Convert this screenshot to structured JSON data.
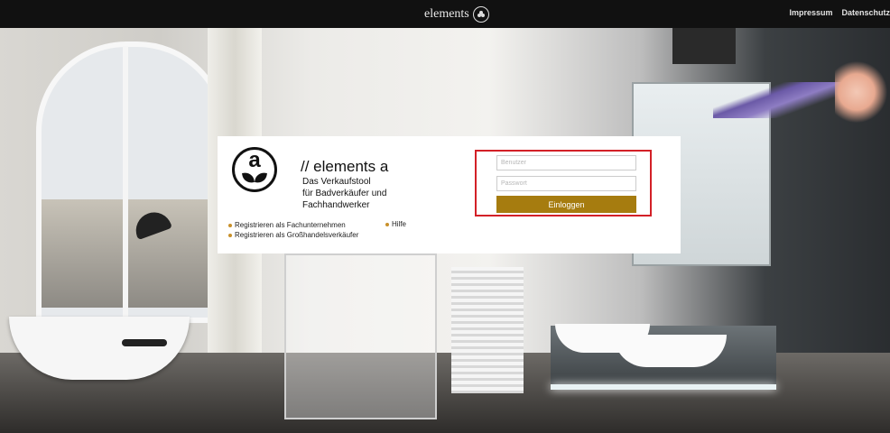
{
  "topbar": {
    "brand": "elements",
    "links": [
      "Impressum",
      "Datenschutz"
    ]
  },
  "card": {
    "title": "// elements a",
    "subtitle_lines": [
      "Das Verkaufstool",
      "für Badverkäufer und",
      "Fachhandwerker"
    ],
    "links": {
      "register_trade": "Registrieren als Fachunternehmen",
      "help": "Hilfe",
      "register_wholesale": "Registrieren als Großhandelsverkäufer"
    },
    "logo_letter": "a"
  },
  "login": {
    "username_placeholder": "Benutzer",
    "password_placeholder": "Passwort",
    "submit_label": "Einloggen"
  },
  "colors": {
    "accent": "#a67c0f",
    "bullet": "#c8902a",
    "highlight_border": "#d32027"
  }
}
